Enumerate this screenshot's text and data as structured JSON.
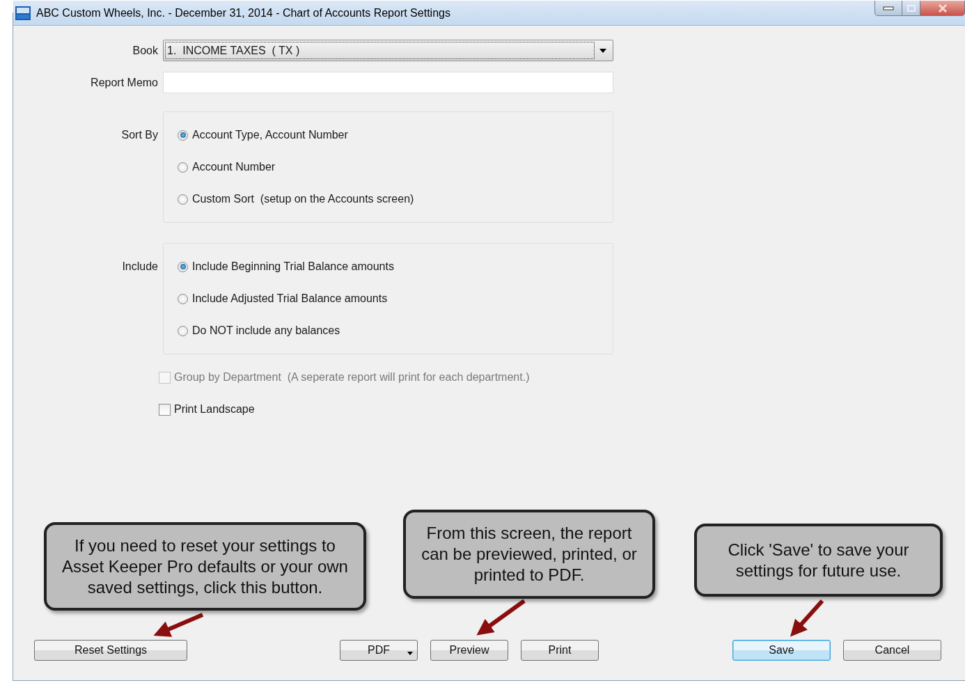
{
  "window": {
    "title": "ABC Custom Wheels, Inc. - December 31, 2014 - Chart of Accounts Report Settings"
  },
  "form": {
    "book": {
      "label": "Book",
      "value": "1.  INCOME TAXES  ( TX )"
    },
    "memo": {
      "label": "Report Memo"
    },
    "sort_by": {
      "label": "Sort By",
      "options": [
        {
          "label": "Account Type, Account Number",
          "selected": true
        },
        {
          "label": "Account Number",
          "selected": false
        },
        {
          "label": "Custom Sort  (setup on the Accounts screen)",
          "selected": false
        }
      ]
    },
    "include": {
      "label": "Include",
      "options": [
        {
          "label": "Include Beginning Trial Balance amounts",
          "selected": true
        },
        {
          "label": "Include Adjusted Trial Balance amounts",
          "selected": false
        },
        {
          "label": "Do NOT include any balances",
          "selected": false
        }
      ]
    },
    "checkboxes": [
      {
        "label": "Group by Department  (A seperate report will print for each department.)",
        "checked": false,
        "disabled": true
      },
      {
        "label": "Print Landscape",
        "checked": false,
        "disabled": false
      }
    ]
  },
  "button_groups": [
    {
      "buttons": [
        {
          "label": "Reset Settings",
          "kind": "plain"
        }
      ]
    },
    {
      "buttons": [
        {
          "label": "PDF",
          "kind": "dropdown"
        },
        {
          "label": "Preview",
          "kind": "plain"
        },
        {
          "label": "Print",
          "kind": "plain"
        }
      ]
    },
    {
      "buttons": [
        {
          "label": "Save",
          "kind": "default"
        },
        {
          "label": "Cancel",
          "kind": "plain"
        }
      ]
    }
  ],
  "callouts": [
    {
      "text": "If you need to reset your settings to Asset Keeper Pro defaults or your own saved settings, click this button."
    },
    {
      "text": "From this screen, the report can be previewed, printed, or printed to PDF."
    },
    {
      "text": "Click 'Save' to save your settings for future use."
    }
  ]
}
